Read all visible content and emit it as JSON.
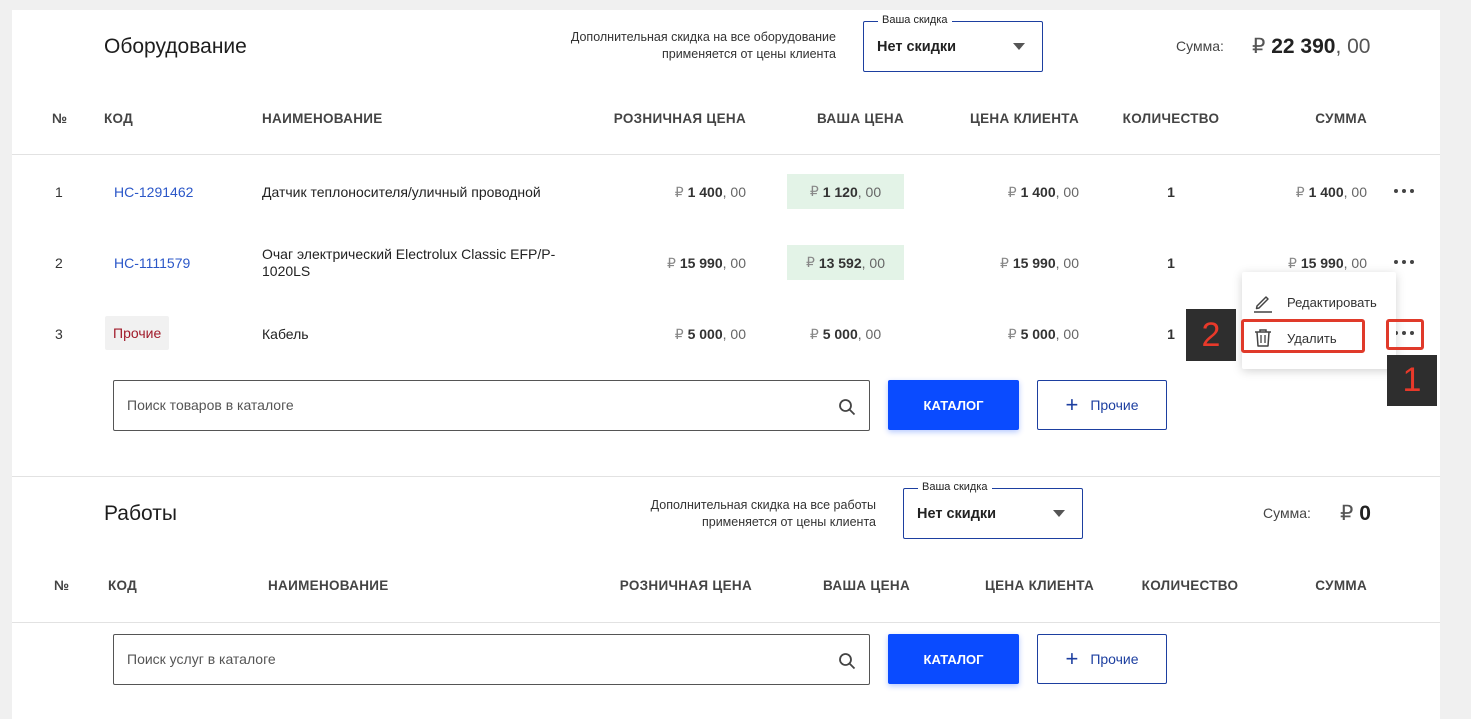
{
  "equipment": {
    "title": "Оборудование",
    "discount_note_line1": "Дополнительная скидка на все оборудование",
    "discount_note_line2": "применяется от цены клиента",
    "discount_select": {
      "legend": "Ваша скидка",
      "value": "Нет скидки"
    },
    "sum_label": "Сумма:",
    "sum_currency": "₽",
    "sum_int": "22 390",
    "sum_dec": ", 00",
    "headers": {
      "no": "№",
      "code": "КОД",
      "name": "НАИМЕНОВАНИЕ",
      "retail": "РОЗНИЧНАЯ ЦЕНА",
      "your": "ВАША ЦЕНА",
      "client": "ЦЕНА КЛИЕНТА",
      "qty": "КОЛИЧЕСТВО",
      "sum": "СУММА"
    },
    "rows": [
      {
        "no": "1",
        "code": "НС-1291462",
        "name_l1": "Датчик теплоносителя/уличный проводной",
        "name_l2": "",
        "retail_int": "1 400",
        "your_int": "1 120",
        "client_int": "1 400",
        "qty": "1",
        "sum_int": "1 400"
      },
      {
        "no": "2",
        "code": "НС-1111579",
        "name_l1": "Очаг электрический Electrolux Classic EFP/P-",
        "name_l2": "1020LS",
        "retail_int": "15 990",
        "your_int": "13 592",
        "client_int": "15 990",
        "qty": "1",
        "sum_int": "15 990"
      },
      {
        "no": "3",
        "code": "Прочие",
        "name_l1": "Кабель",
        "name_l2": "",
        "retail_int": "5 000",
        "your_int": "5 000",
        "client_int": "5 000",
        "qty": "1",
        "sum_int": ""
      }
    ],
    "currency": "₽",
    "decimals": ", 00",
    "search_placeholder": "Поиск товаров в каталоге",
    "catalog_label": "КАТАЛОГ",
    "other_label": "Прочие",
    "plus": "+"
  },
  "context_menu": {
    "edit_label": "Редактировать",
    "delete_label": "Удалить"
  },
  "annotations": {
    "badge1": "1",
    "badge2": "2",
    "color": "#e03a2a"
  },
  "works": {
    "title": "Работы",
    "discount_note_line1": "Дополнительная скидка на все работы",
    "discount_note_line2": "применяется от цены клиента",
    "discount_select": {
      "legend": "Ваша скидка",
      "value": "Нет скидки"
    },
    "sum_label": "Сумма:",
    "sum_currency": "₽",
    "sum_value": "0",
    "headers": {
      "no": "№",
      "code": "КОД",
      "name": "НАИМЕНОВАНИЕ",
      "retail": "РОЗНИЧНАЯ ЦЕНА",
      "your": "ВАША ЦЕНА",
      "client": "ЦЕНА КЛИЕНТА",
      "qty": "КОЛИЧЕСТВО",
      "sum": "СУММА"
    },
    "search_placeholder": "Поиск услуг в каталоге",
    "catalog_label": "КАТАЛОГ",
    "other_label": "Прочие",
    "plus": "+"
  },
  "colors": {
    "accent": "#0a4bff",
    "link": "#2b57c8",
    "highlight_bg": "#e3f3e7",
    "other_chip_text": "#a11b2a"
  },
  "icons": {
    "search": "search-icon",
    "dropdown": "chevron-down-icon",
    "edit": "pencil-icon",
    "delete": "trash-icon",
    "more": "more-dots-icon",
    "add": "plus-icon"
  }
}
